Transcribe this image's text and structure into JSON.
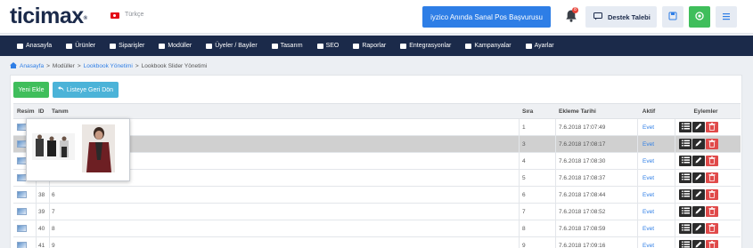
{
  "header": {
    "logo_text": "ticimax",
    "logo_mark": "®",
    "language": "Türkçe",
    "iyzico_button": "iyzico Anında Sanal Pos Başvurusu",
    "notification_count": "8",
    "support_button": "Destek Talebi"
  },
  "nav": {
    "items": [
      {
        "label": "Anasayfa",
        "icon": "home-icon"
      },
      {
        "label": "Ürünler",
        "icon": "folder-icon"
      },
      {
        "label": "Siparişler",
        "icon": "list-icon"
      },
      {
        "label": "Modüller",
        "icon": "briefcase-icon"
      },
      {
        "label": "Üyeler / Bayiler",
        "icon": "users-icon"
      },
      {
        "label": "Tasarım",
        "icon": "palette-icon"
      },
      {
        "label": "SEO",
        "icon": "rocket-icon"
      },
      {
        "label": "Raporlar",
        "icon": "chart-icon"
      },
      {
        "label": "Entegrasyonlar",
        "icon": "puzzle-icon"
      },
      {
        "label": "Kampanyalar",
        "icon": "refresh-icon"
      },
      {
        "label": "Ayarlar",
        "icon": "wrench-icon"
      }
    ]
  },
  "breadcrumb": {
    "home": "Anasayfa",
    "sep": ">",
    "modules": "Modüller",
    "lookbook": "Lookbook Yönetimi",
    "current": "Lookbook Slider Yönetimi"
  },
  "toolbar": {
    "new_label": "Yeni Ekle",
    "back_label": "Listeye Geri Dön"
  },
  "table": {
    "columns": {
      "image": "Resim",
      "id": "ID",
      "name": "Tanım",
      "order": "Sıra",
      "date": "Ekleme Tarihi",
      "active": "Aktif",
      "actions": "Eylemler"
    },
    "rows": [
      {
        "id": "",
        "name": "",
        "order": "1",
        "date": "7.6.2018 17:07:49",
        "active": "Evet"
      },
      {
        "id": "",
        "name": "",
        "order": "3",
        "date": "7.6.2018 17:08:17",
        "active": "Evet"
      },
      {
        "id": "",
        "name": "",
        "order": "4",
        "date": "7.6.2018 17:08:30",
        "active": "Evet"
      },
      {
        "id": "",
        "name": "",
        "order": "5",
        "date": "7.6.2018 17:08:37",
        "active": "Evet"
      },
      {
        "id": "38",
        "name": "6",
        "order": "6",
        "date": "7.6.2018 17:08:44",
        "active": "Evet"
      },
      {
        "id": "39",
        "name": "7",
        "order": "7",
        "date": "7.6.2018 17:08:52",
        "active": "Evet"
      },
      {
        "id": "40",
        "name": "8",
        "order": "8",
        "date": "7.6.2018 17:08:59",
        "active": "Evet"
      },
      {
        "id": "41",
        "name": "9",
        "order": "9",
        "date": "7.6.2018 17:09:16",
        "active": "Evet"
      }
    ],
    "selected_row": 1
  },
  "colors": {
    "navy": "#1b2a4a",
    "blue": "#2e7ee6",
    "green": "#3fbe5b",
    "cyan": "#4bb3d8",
    "red": "#e04a4a"
  }
}
